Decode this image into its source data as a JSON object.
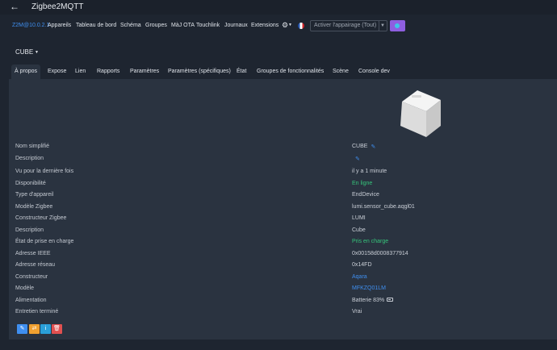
{
  "app": {
    "back_icon": "arrow-left-icon",
    "title": "Zigbee2MQTT"
  },
  "nav": {
    "version": "Z2M@10.0.2.1",
    "items": [
      "Appareils",
      "Tableau de bord",
      "Schéma",
      "Groupes",
      "MàJ OTA",
      "Touchlink",
      "Journaux",
      "Extensions"
    ],
    "settings_icon": "gear-icon",
    "language_icon": "flag-fr-icon",
    "pairing_label": "Activer l'appairage (Tout)",
    "pairing_button_color": "#8e5fe0"
  },
  "device": {
    "name": "CUBE"
  },
  "tabs": [
    "À propos",
    "Expose",
    "Lien",
    "Rapports",
    "Paramètres",
    "Paramètres (spécifiques)",
    "État",
    "Groupes de fonctionnalités",
    "Scène",
    "Console dev"
  ],
  "active_tab": "À propos",
  "details": {
    "rows": [
      {
        "label": "Nom simplifié",
        "value": "CUBE"
      },
      {
        "label": "Description",
        "value": ""
      },
      {
        "label": "Vu pour la dernière fois",
        "value": "il y a 1 minute"
      },
      {
        "label": "Disponibilité",
        "value": "En ligne"
      },
      {
        "label": "Type d'appareil",
        "value": "EndDevice"
      },
      {
        "label": "Modèle Zigbee",
        "value": "lumi.sensor_cube.aqgl01"
      },
      {
        "label": "Constructeur Zigbee",
        "value": "LUMI"
      },
      {
        "label": "Description",
        "value": "Cube"
      },
      {
        "label": "État de prise en charge",
        "value": "Pris en charge"
      },
      {
        "label": "Adresse IEEE",
        "value": "0x00158d0008377914"
      },
      {
        "label": "Adresse réseau",
        "value": "0x14FD"
      },
      {
        "label": "Constructeur",
        "value": "Aqara"
      },
      {
        "label": "Modèle",
        "value": "MFKZQ01LM"
      },
      {
        "label": "Alimentation",
        "value": "Batterie 83%"
      },
      {
        "label": "Entretien terminé",
        "value": "Vrai"
      }
    ],
    "battery_level": 0.83
  },
  "actions": [
    "edit-icon",
    "swap-icon",
    "info-icon",
    "trash-icon"
  ],
  "colors": {
    "accent": "#3f8ff0",
    "success": "#36c37a",
    "warning": "#f0a030",
    "danger": "#e05050"
  }
}
